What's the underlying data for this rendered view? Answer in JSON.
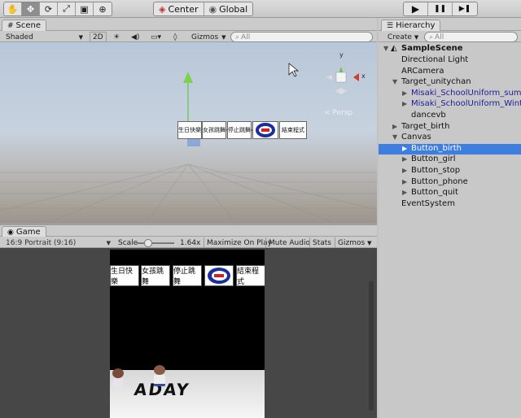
{
  "toolbar": {
    "tools": [
      {
        "name": "hand-tool",
        "glyph": "✋"
      },
      {
        "name": "move-tool",
        "glyph": "✥"
      },
      {
        "name": "rotate-tool",
        "glyph": "⟳"
      },
      {
        "name": "scale-tool",
        "glyph": "⤢"
      },
      {
        "name": "rect-tool",
        "glyph": "▣"
      },
      {
        "name": "transform-tool",
        "glyph": "⊕"
      }
    ],
    "pivot_center": "Center",
    "pivot_global": "Global",
    "play_glyph": "▶",
    "pause_glyph": "❚❚",
    "step_glyph": "▶❚"
  },
  "scene": {
    "tab_label": "Scene",
    "shading_mode": "Shaded",
    "mode_2d": "2D",
    "gizmos_label": "Gizmos",
    "search_placeholder": "All",
    "persp_label": "< Persp",
    "world_buttons": [
      "生日快樂",
      "女孩跳舞",
      "停止跳舞",
      "",
      "結束程式"
    ]
  },
  "game": {
    "tab_label": "Game",
    "aspect": "16:9 Portrait (9:16)",
    "scale_label": "Scale",
    "scale_value": "1.64x",
    "scale_fraction": 0.3,
    "maximize_on_play": "Maximize On Play",
    "mute_audio": "Mute Audio",
    "stats": "Stats",
    "gizmos": "Gizmos",
    "buttons": [
      "生日快樂",
      "女孩跳舞",
      "停止跳舞",
      "",
      "結束程式"
    ],
    "stage_text": "ADAY"
  },
  "hierarchy": {
    "tab_label": "Hierarchy",
    "create_label": "Create",
    "search_placeholder": "All",
    "scene_name": "SampleScene",
    "items": [
      {
        "label": "Directional Light",
        "depth": 1,
        "arrow": "",
        "prefab": false,
        "selected": false
      },
      {
        "label": "ARCamera",
        "depth": 1,
        "arrow": "",
        "prefab": false,
        "selected": false
      },
      {
        "label": "Target_unitychan",
        "depth": 1,
        "arrow": "▼",
        "prefab": false,
        "selected": false
      },
      {
        "label": "Misaki_SchoolUniform_summer",
        "depth": 2,
        "arrow": "▶",
        "prefab": true,
        "selected": false
      },
      {
        "label": "Misaki_SchoolUniform_Winter",
        "depth": 2,
        "arrow": "▶",
        "prefab": true,
        "selected": false
      },
      {
        "label": "dancevb",
        "depth": 2,
        "arrow": "",
        "prefab": false,
        "selected": false
      },
      {
        "label": "Target_birth",
        "depth": 1,
        "arrow": "▶",
        "prefab": false,
        "selected": false
      },
      {
        "label": "Canvas",
        "depth": 1,
        "arrow": "▼",
        "prefab": false,
        "selected": false
      },
      {
        "label": "Button_birth",
        "depth": 2,
        "arrow": "▶",
        "prefab": false,
        "selected": true
      },
      {
        "label": "Button_girl",
        "depth": 2,
        "arrow": "▶",
        "prefab": false,
        "selected": false
      },
      {
        "label": "Button_stop",
        "depth": 2,
        "arrow": "▶",
        "prefab": false,
        "selected": false
      },
      {
        "label": "Button_phone",
        "depth": 2,
        "arrow": "▶",
        "prefab": false,
        "selected": false
      },
      {
        "label": "Button_quit",
        "depth": 2,
        "arrow": "▶",
        "prefab": false,
        "selected": false
      },
      {
        "label": "EventSystem",
        "depth": 1,
        "arrow": "",
        "prefab": false,
        "selected": false
      }
    ]
  }
}
